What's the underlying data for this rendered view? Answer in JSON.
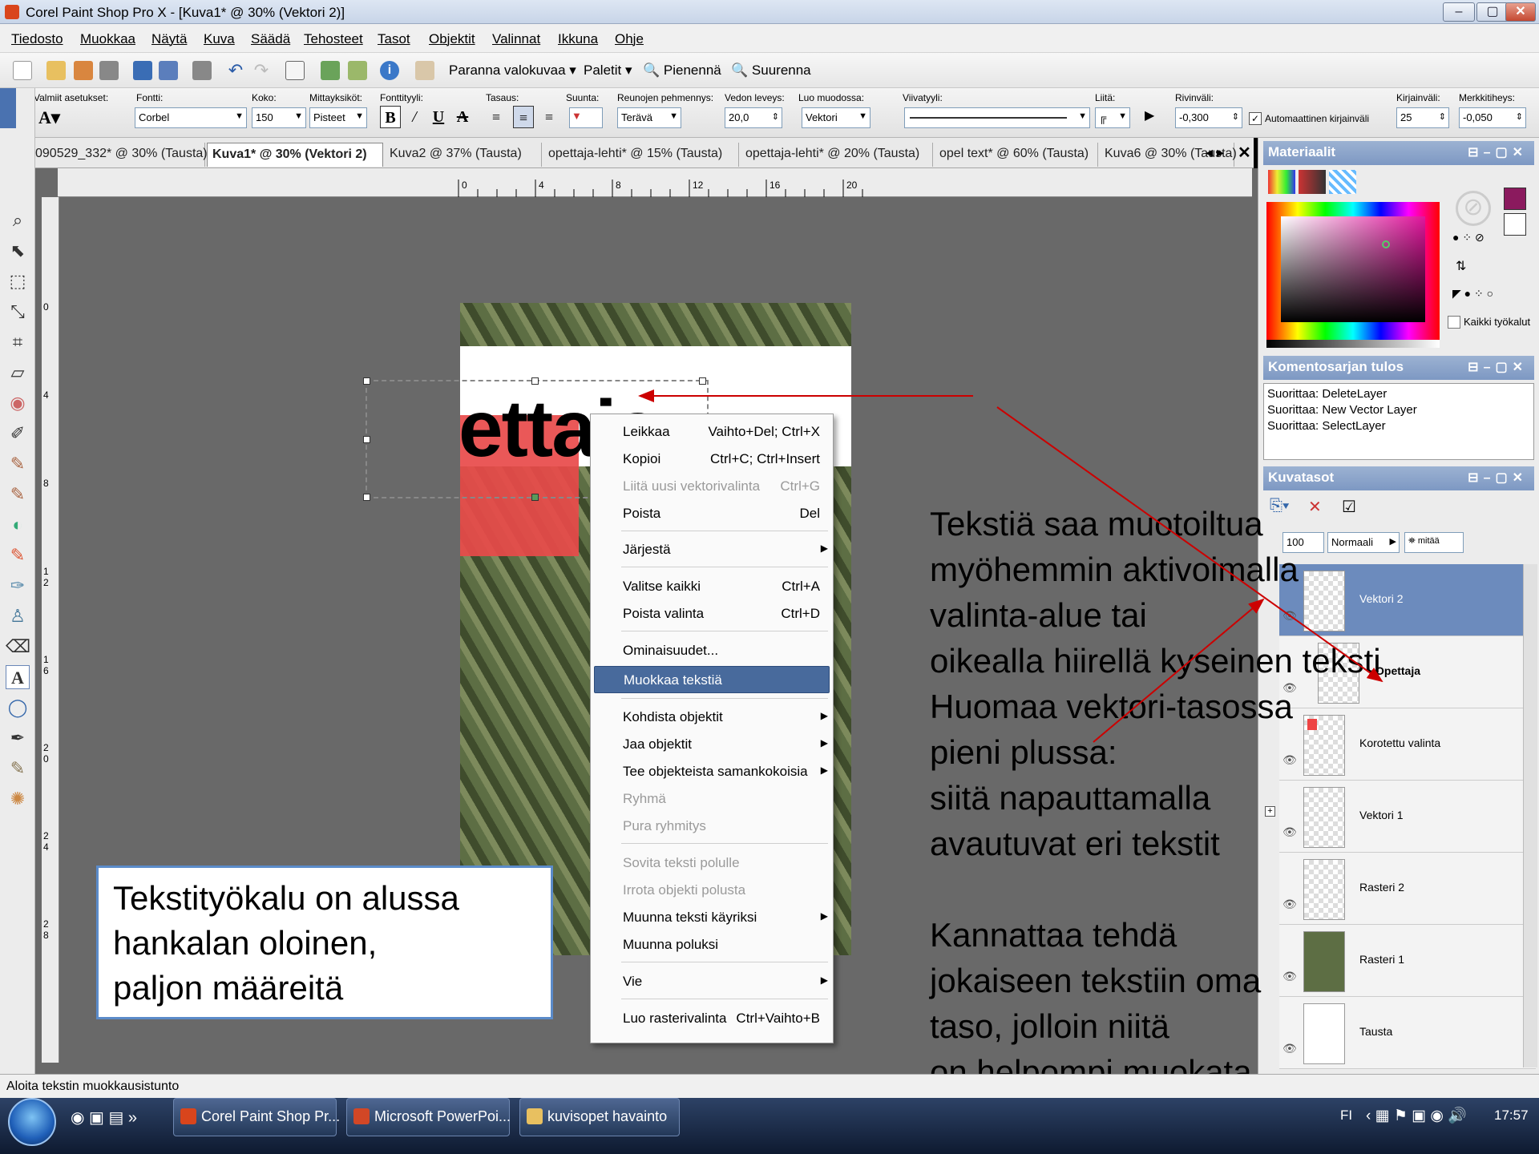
{
  "window": {
    "title": "Corel Paint Shop Pro X - [Kuva1* @  30% (Vektori 2)]",
    "min": "–",
    "max": "▢",
    "close": "✕"
  },
  "menu": [
    "Tiedosto",
    "Muokkaa",
    "Näytä",
    "Kuva",
    "Säädä",
    "Tehosteet",
    "Tasot",
    "Objektit",
    "Valinnat",
    "Ikkuna",
    "Ohje"
  ],
  "toolbar": {
    "enhance": "Paranna valokuvaa",
    "palettes": "Paletit",
    "zoom_out": "Pienennä",
    "zoom_in": "Suurenna"
  },
  "textopts": {
    "presets_label": "Valmiit asetukset:",
    "font_label": "Fontti:",
    "font_value": "Corbel",
    "size_label": "Koko:",
    "size_value": "150",
    "units_label": "Mittayksiköt:",
    "units_value": "Pisteet",
    "style_label": "Fonttityyli:",
    "align_label": "Tasaus:",
    "direction_label": "Suunta:",
    "antialias_label": "Reunojen pehmennys:",
    "antialias_value": "Terävä",
    "stroke_label": "Vedon leveys:",
    "stroke_value": "20,0",
    "create_as_label": "Luo muodossa:",
    "create_as_value": "Vektori",
    "linestyle_label": "Viivatyyli:",
    "join_label": "Liitä:",
    "leading_label": "Rivinväli:",
    "leading_value": "-0,300",
    "autokern_label": "Automaattinen kirjainväli",
    "kerning_label": "Kirjainväli:",
    "kerning_value": "25",
    "tracking_label": "Merkkitiheys:",
    "tracking_value": "-0,050"
  },
  "tabs": [
    "090529_332* @  30% (Tausta)",
    "Kuva1* @  30% (Vektori 2)",
    "Kuva2 @  37% (Tausta)",
    "opettaja-lehti* @  15% (Tausta)",
    "opettaja-lehti* @  20% (Tausta)",
    "opel text* @  60% (Tausta)",
    "Kuva6 @  30% (Tausta)"
  ],
  "ruler": {
    "h": [
      "0",
      "4",
      "8",
      "12",
      "16",
      "20"
    ],
    "v": [
      "0",
      "4",
      "8",
      "1 2",
      "1 6",
      "2 0",
      "2 4",
      "2 8"
    ]
  },
  "document": {
    "visible_text": "ettaja"
  },
  "context_menu": [
    {
      "label": "Leikkaa",
      "shortcut": "Vaihto+Del; Ctrl+X"
    },
    {
      "label": "Kopioi",
      "shortcut": "Ctrl+C; Ctrl+Insert"
    },
    {
      "label": "Liitä uusi vektorivalinta",
      "shortcut": "Ctrl+G"
    },
    {
      "label": "Poista",
      "shortcut": "Del"
    },
    {
      "label": "Järjestä",
      "shortcut": ""
    },
    {
      "label": "Valitse kaikki",
      "shortcut": "Ctrl+A"
    },
    {
      "label": "Poista valinta",
      "shortcut": "Ctrl+D"
    },
    {
      "label": "Ominaisuudet...",
      "shortcut": ""
    },
    {
      "label": "Muokkaa tekstiä",
      "shortcut": ""
    },
    {
      "label": "Kohdista objektit",
      "shortcut": ""
    },
    {
      "label": "Jaa objektit",
      "shortcut": ""
    },
    {
      "label": "Tee objekteista samankokoisia",
      "shortcut": ""
    },
    {
      "label": "Ryhmä",
      "shortcut": ""
    },
    {
      "label": "Pura ryhmitys",
      "shortcut": ""
    },
    {
      "label": "Sovita teksti polulle",
      "shortcut": ""
    },
    {
      "label": "Irrota objekti polusta",
      "shortcut": ""
    },
    {
      "label": "Muunna teksti käyriksi",
      "shortcut": ""
    },
    {
      "label": "Muunna poluksi",
      "shortcut": ""
    },
    {
      "label": "Vie",
      "shortcut": ""
    },
    {
      "label": "Luo rasterivalinta",
      "shortcut": "Ctrl+Vaihto+B"
    }
  ],
  "callout": [
    "Tekstityökalu on alussa",
    "hankalan oloinen,",
    "paljon määreitä"
  ],
  "notes": [
    "Tekstiä saa muotoiltua",
    "myöhemmin aktivoimalla",
    "valinta-alue tai",
    "oikealla hiirellä kyseinen teksti",
    "Huomaa vektori-tasossa",
    "pieni plussa:",
    "siitä napauttamalla",
    "avautuvat eri tekstit",
    "",
    "Kannattaa tehdä",
    "jokaiseen tekstiin oma",
    "taso, jolloin niitä",
    "on helpompi muokata"
  ],
  "panels": {
    "materials": "Materiaalit",
    "all_tools": "Kaikki työkalut",
    "script_output": "Komentosarjan tulos",
    "script_lines": [
      "Suorittaa: DeleteLayer",
      "Suorittaa: New Vector Layer",
      "Suorittaa: SelectLayer"
    ],
    "layers": "Kuvatasot",
    "opacity": "100",
    "blend": "Normaali",
    "mask": "mitää",
    "layer_names": [
      "Vektori 2",
      "Opettaja",
      "Korotettu valinta",
      "Vektori 1",
      "Rasteri 2",
      "Rasteri 1",
      "Tausta"
    ]
  },
  "status": "Aloita tekstin muokkausistunto",
  "taskbar": {
    "apps": [
      "Corel Paint Shop Pr...",
      "Microsoft PowerPoi...",
      "kuvisopet havainto"
    ],
    "lang": "FI",
    "time": "17:57"
  },
  "colors": {
    "accent": "#486a9c",
    "arrow": "#cc0000",
    "fg_swatch": "#8b1a5e"
  }
}
